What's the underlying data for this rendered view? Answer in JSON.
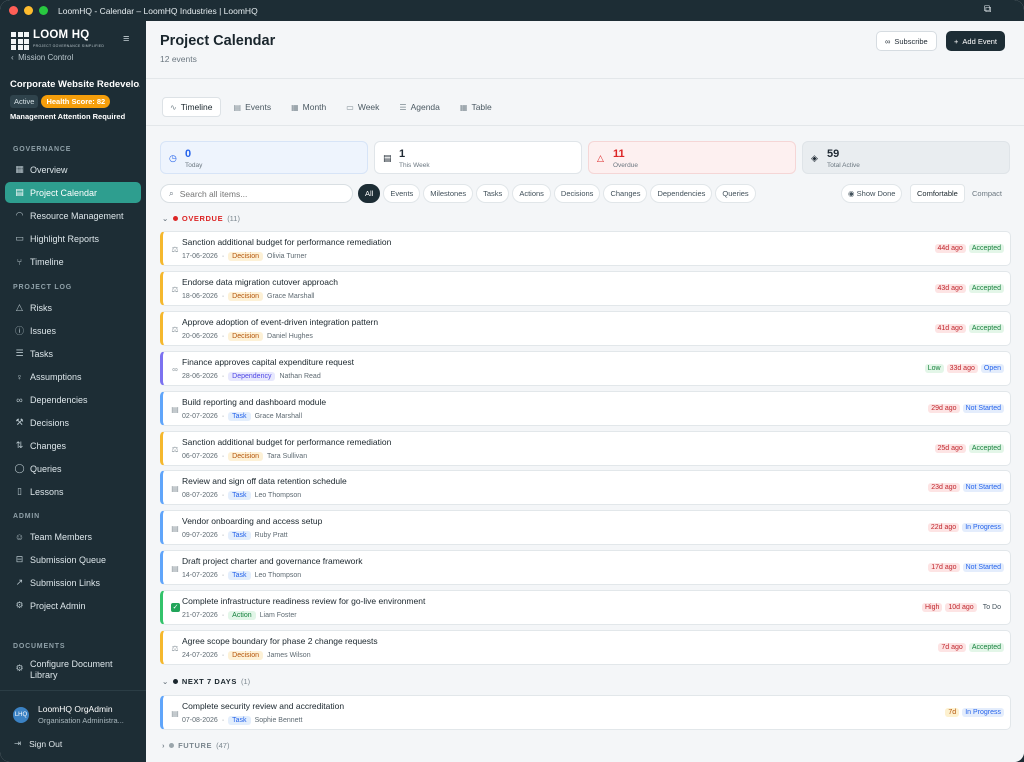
{
  "window": {
    "title": "LoomHQ - Calendar – LoomHQ Industries | LoomHQ"
  },
  "sidebar": {
    "logo_text": "LOOM HQ",
    "logo_sub": "PROJECT GOVERNANCE SIMPLIFIED",
    "back_label": "Mission Control",
    "project_name": "Corporate Website Redevelo...",
    "status": "Active",
    "health": "Health Score: 82",
    "attention": "Management Attention Required",
    "sections": {
      "governance": "GOVERNANCE",
      "project_log": "PROJECT LOG",
      "admin": "ADMIN",
      "documents": "DOCUMENTS"
    },
    "governance_items": [
      "Overview",
      "Project Calendar",
      "Resource Management",
      "Highlight Reports",
      "Timeline"
    ],
    "log_items": [
      "Risks",
      "Issues",
      "Tasks",
      "Assumptions",
      "Dependencies",
      "Decisions",
      "Changes",
      "Queries",
      "Lessons"
    ],
    "admin_items": [
      "Team Members",
      "Submission Queue",
      "Submission Links",
      "Project Admin"
    ],
    "document_items": [
      "Configure Document Library"
    ],
    "user": {
      "initials": "LHQ",
      "name": "LoomHQ OrgAdmin",
      "role": "Organisation Administra..."
    },
    "signout": "Sign Out"
  },
  "header": {
    "title": "Project Calendar",
    "subtitle": "12 events",
    "subscribe": "Subscribe",
    "add_event": "Add Event"
  },
  "tabs": [
    "Timeline",
    "Events",
    "Month",
    "Week",
    "Agenda",
    "Table"
  ],
  "stats": [
    {
      "value": "0",
      "label": "Today"
    },
    {
      "value": "1",
      "label": "This Week"
    },
    {
      "value": "11",
      "label": "Overdue"
    },
    {
      "value": "59",
      "label": "Total Active"
    }
  ],
  "search": {
    "placeholder": "Search all items..."
  },
  "filters": [
    "All",
    "Events",
    "Milestones",
    "Tasks",
    "Actions",
    "Decisions",
    "Changes",
    "Dependencies",
    "Queries"
  ],
  "controls": {
    "show_done": "Show Done",
    "comfortable": "Comfortable",
    "compact": "Compact"
  },
  "groups": {
    "overdue": {
      "label": "OVERDUE",
      "count": "(11)"
    },
    "next7": {
      "label": "NEXT 7 DAYS",
      "count": "(1)"
    },
    "future": {
      "label": "FUTURE",
      "count": "(47)"
    }
  },
  "overdue_items": [
    {
      "title": "Sanction additional budget for performance remediation",
      "date": "17-06-2026",
      "type": "Decision",
      "owner": "Olivia Turner",
      "ago": "44d ago",
      "status": "Accepted"
    },
    {
      "title": "Endorse data migration cutover approach",
      "date": "18-06-2026",
      "type": "Decision",
      "owner": "Grace Marshall",
      "ago": "43d ago",
      "status": "Accepted"
    },
    {
      "title": "Approve adoption of event-driven integration pattern",
      "date": "20-06-2026",
      "type": "Decision",
      "owner": "Daniel Hughes",
      "ago": "41d ago",
      "status": "Accepted"
    },
    {
      "title": "Finance approves capital expenditure request",
      "date": "28-06-2026",
      "type": "Dependency",
      "owner": "Nathan Read",
      "priority": "Low",
      "ago": "33d ago",
      "status": "Open"
    },
    {
      "title": "Build reporting and dashboard module",
      "date": "02-07-2026",
      "type": "Task",
      "owner": "Grace Marshall",
      "ago": "29d ago",
      "status": "Not Started"
    },
    {
      "title": "Sanction additional budget for performance remediation",
      "date": "06-07-2026",
      "type": "Decision",
      "owner": "Tara Sullivan",
      "ago": "25d ago",
      "status": "Accepted"
    },
    {
      "title": "Review and sign off data retention schedule",
      "date": "08-07-2026",
      "type": "Task",
      "owner": "Leo Thompson",
      "ago": "23d ago",
      "status": "Not Started"
    },
    {
      "title": "Vendor onboarding and access setup",
      "date": "09-07-2026",
      "type": "Task",
      "owner": "Ruby Pratt",
      "ago": "22d ago",
      "status": "In Progress"
    },
    {
      "title": "Draft project charter and governance framework",
      "date": "14-07-2026",
      "type": "Task",
      "owner": "Leo Thompson",
      "ago": "17d ago",
      "status": "Not Started"
    },
    {
      "title": "Complete infrastructure readiness review for go-live environment",
      "date": "21-07-2026",
      "type": "Action",
      "owner": "Liam Foster",
      "priority": "High",
      "ago": "10d ago",
      "status": "To Do"
    },
    {
      "title": "Agree scope boundary for phase 2 change requests",
      "date": "24-07-2026",
      "type": "Decision",
      "owner": "James Wilson",
      "ago": "7d ago",
      "status": "Accepted"
    }
  ],
  "next7_items": [
    {
      "title": "Complete security review and accreditation",
      "date": "07-08-2026",
      "type": "Task",
      "owner": "Sophie Bennett",
      "ago": "7d",
      "status": "In Progress"
    }
  ],
  "colors": {
    "accent": "#2e9e8f",
    "sidebar": "#1d2d35",
    "overdue": "#dc2626",
    "health": "#f59e0b"
  }
}
